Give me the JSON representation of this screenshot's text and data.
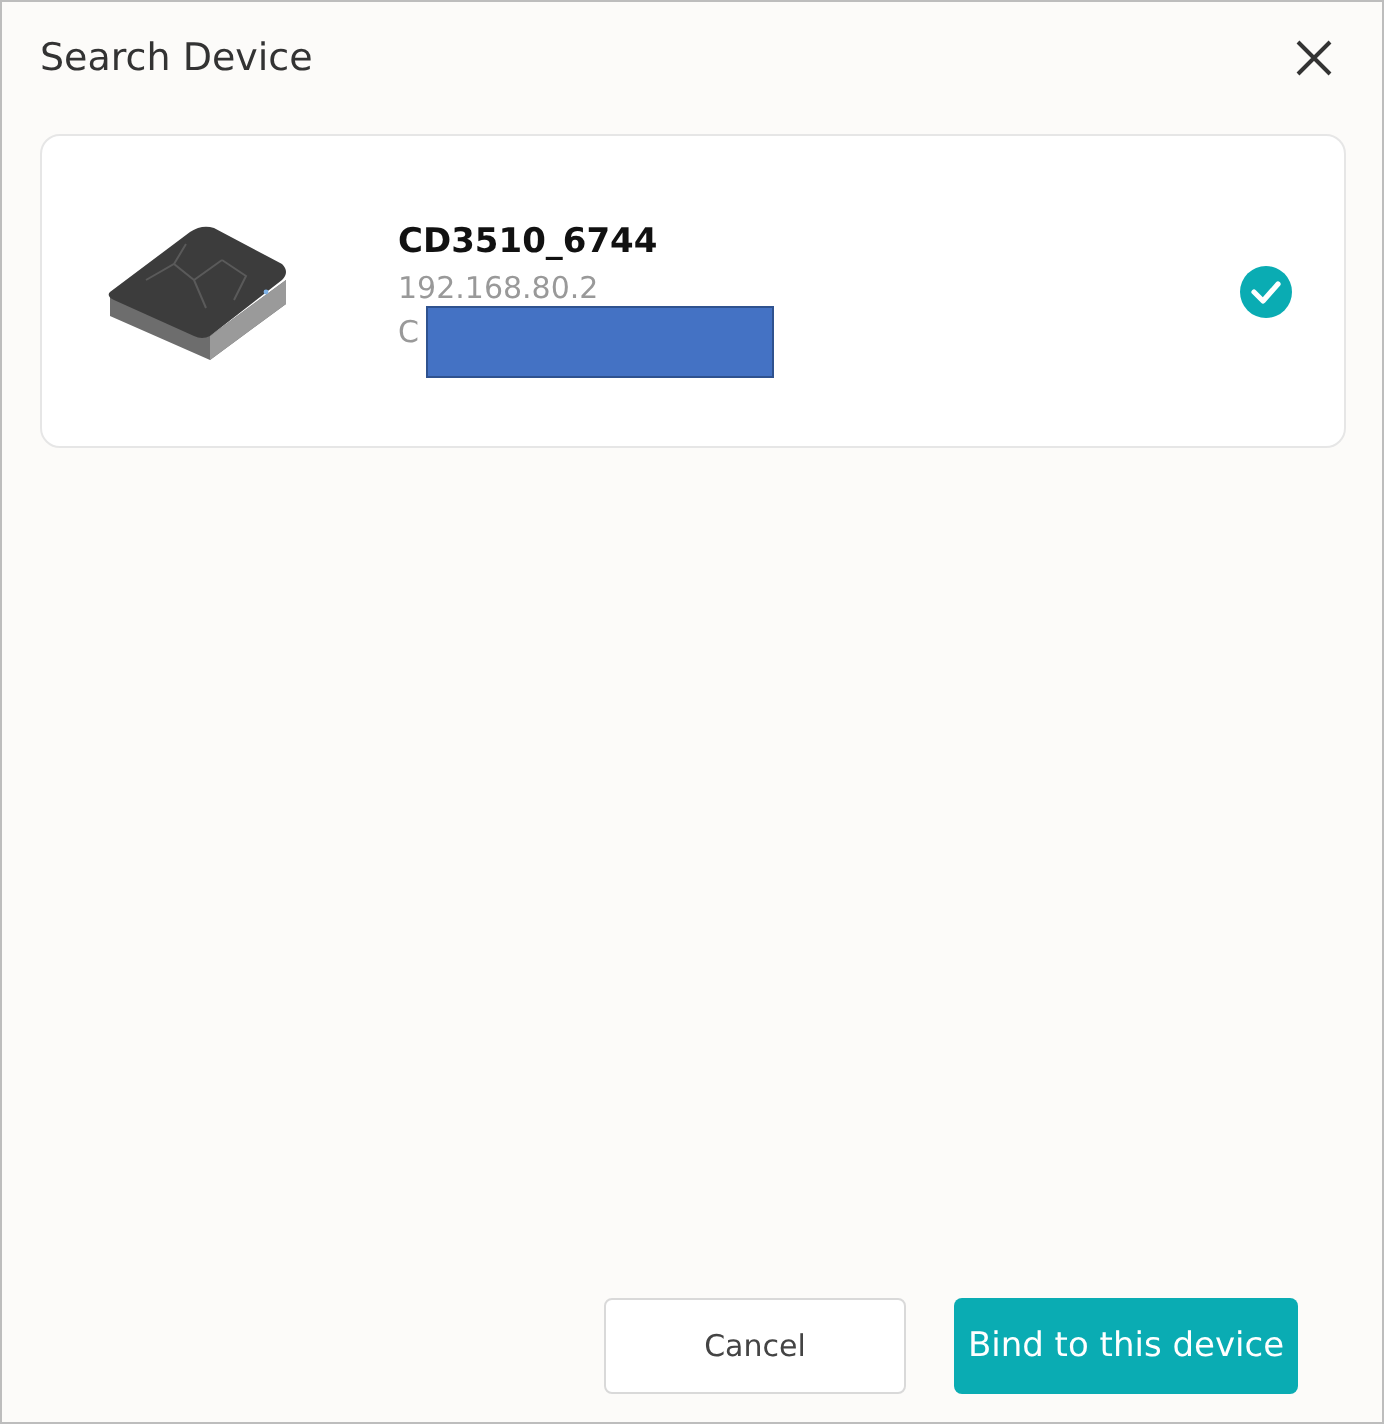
{
  "dialog": {
    "title": "Search Device"
  },
  "devices": [
    {
      "kind": "picture",
      "name": "CD3510_6744",
      "ip": "192.168.80.2",
      "detail": "C",
      "redacted": true,
      "selected": true
    }
  ],
  "buttons": [
    {
      "kind": "secondary",
      "label": "Cancel"
    },
    {
      "kind": "primary",
      "label": "Bind to this device"
    }
  ]
}
